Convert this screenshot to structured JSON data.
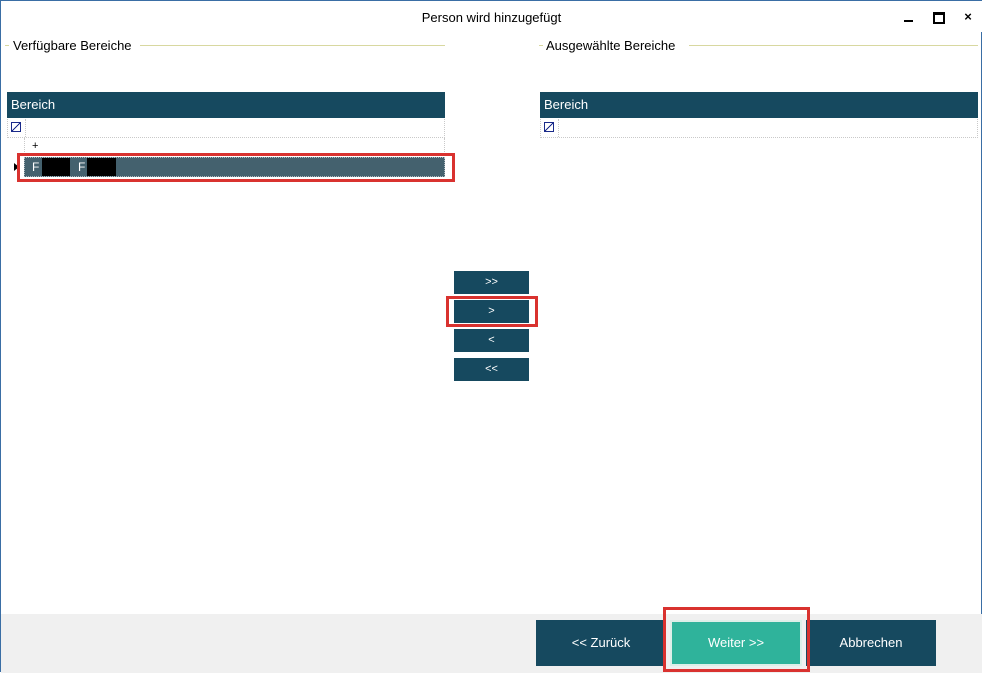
{
  "window": {
    "title": "Person wird hinzugefügt",
    "close_glyph": "×"
  },
  "left_panel": {
    "group_title": "Verfügbare Bereiche",
    "column_header": "Bereich",
    "new_row_glyph": "+",
    "rows": [
      {
        "col1": "F",
        "col2": "F"
      }
    ]
  },
  "right_panel": {
    "group_title": "Ausgewählte Bereiche",
    "column_header": "Bereich"
  },
  "move_buttons": {
    "add_all": ">>",
    "add_one": ">",
    "remove_one": "<",
    "remove_all": "<<"
  },
  "footer": {
    "back": "<< Zurück",
    "next": "Weiter >>",
    "cancel": "Abbrechen"
  },
  "colors": {
    "header_bg": "#16495f",
    "selected_row_bg": "#44616e",
    "primary_button": "#2fb39b",
    "highlight": "#d9322f",
    "group_line": "#d8d8a0"
  },
  "icons": {
    "filter": "filter-edit-icon",
    "current_row": "row-indicator-icon"
  }
}
